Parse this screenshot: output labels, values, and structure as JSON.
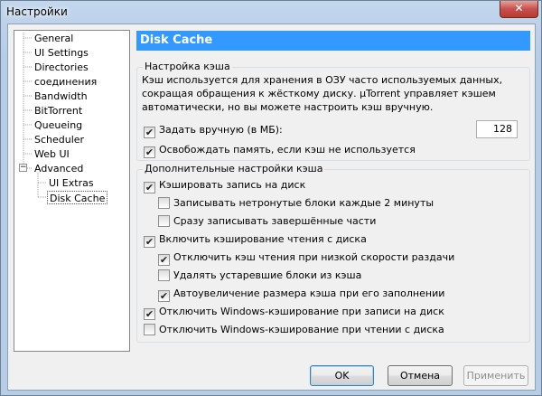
{
  "window": {
    "title": "Настройки",
    "close_glyph": "✕"
  },
  "tree": {
    "items": [
      {
        "label": "General"
      },
      {
        "label": "UI Settings"
      },
      {
        "label": "Directories"
      },
      {
        "label": "соединения"
      },
      {
        "label": "Bandwidth"
      },
      {
        "label": "BitTorrent"
      },
      {
        "label": "Queueing"
      },
      {
        "label": "Scheduler"
      },
      {
        "label": "Web UI"
      },
      {
        "label": "Advanced",
        "expanded": true
      },
      {
        "label": "UI Extras"
      },
      {
        "label": "Disk Cache",
        "selected": true
      }
    ],
    "expander_glyph": "−"
  },
  "banner": {
    "title": "Disk Cache"
  },
  "cache_settings": {
    "title": "Настройка кэша",
    "description": "Кэш используется для хранения в ОЗУ часто используемых данных, сокращая обращения к жёсткому диску. µTorrent управляет кэшем автоматически, но вы можете настроить кэш вручную.",
    "manual_size_label": "Задать вручную (в МБ):",
    "manual_size_checked": true,
    "manual_size_value": "128",
    "free_memory_label": "Освобождать память, если кэш не используется",
    "free_memory_checked": true
  },
  "advanced_cache": {
    "title": "Дополнительные настройки кэша",
    "options": [
      {
        "label": "Кэшировать запись на диск",
        "checked": true
      },
      {
        "label": "Записывать нетронутые блоки каждые 2 минуты",
        "checked": false
      },
      {
        "label": "Сразу записывать завершённые части",
        "checked": false
      },
      {
        "label": "Включить кэширование чтения с диска",
        "checked": true
      },
      {
        "label": "Отключить кэш чтения при низкой скорости раздачи",
        "checked": true
      },
      {
        "label": "Удалять устаревшие блоки из кэша",
        "checked": false
      },
      {
        "label": "Автоувеличение размера кэша при его заполнении",
        "checked": true
      },
      {
        "label": "Отключить Windows-кэширование при записи на диск",
        "checked": true
      },
      {
        "label": "Отключить Windows-кэширование при чтении с диска",
        "checked": false
      }
    ]
  },
  "check_glyph": "✔",
  "buttons": {
    "ok": "OK",
    "cancel": "Отмена",
    "apply": "Применить"
  }
}
